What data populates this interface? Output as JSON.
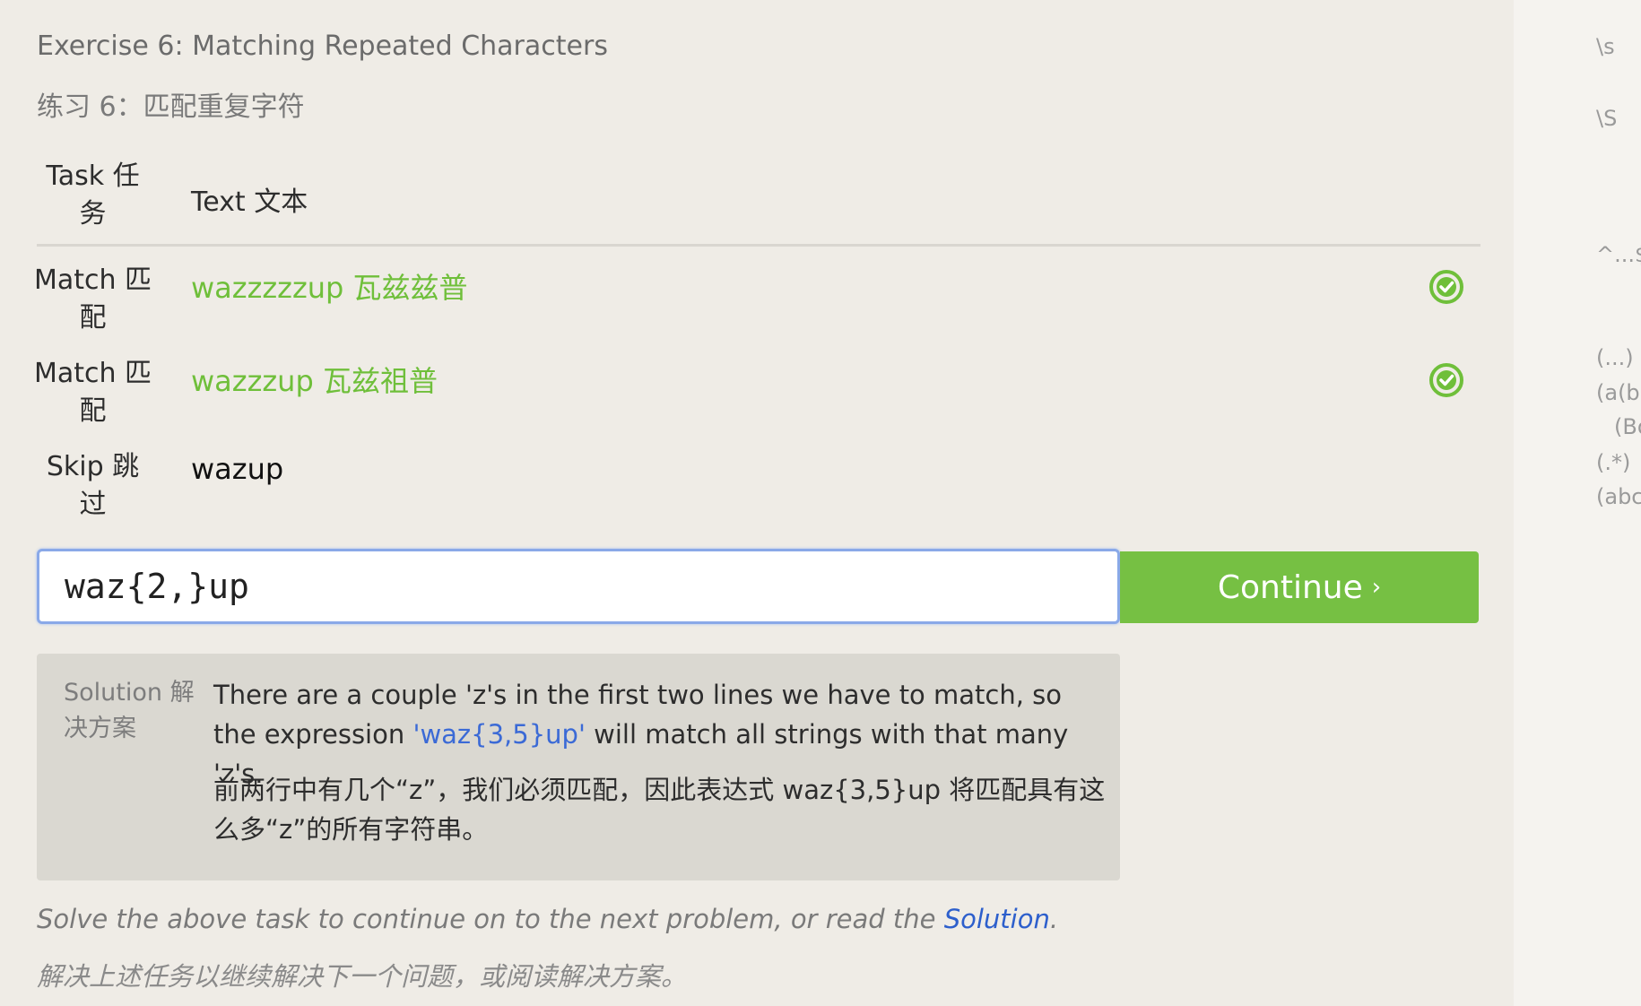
{
  "exercise": {
    "title_en": "Exercise 6: Matching Repeated Characters",
    "title_zh": "练习 6：匹配重复字符"
  },
  "table": {
    "header_task_line1": "Task 任",
    "header_task_line2": "务",
    "header_text": "Text 文本",
    "rows": [
      {
        "task_line1": "Match 匹",
        "task_line2": "配",
        "text": "wazzzzzup 瓦兹兹普",
        "type": "match",
        "status_icon": "check-circle-icon",
        "status_color": "#6fbf3a"
      },
      {
        "task_line1": "Match 匹",
        "task_line2": "配",
        "text": "wazzzup 瓦兹祖普",
        "type": "match",
        "status_icon": "check-circle-icon",
        "status_color": "#6fbf3a"
      },
      {
        "task_line1": "Skip 跳",
        "task_line2": "过",
        "text": "wazup",
        "type": "skip"
      }
    ]
  },
  "regex_input": {
    "value": "waz{2,}up"
  },
  "continue_button": {
    "label": "Continue",
    "chevron": "›",
    "color": "#76c043"
  },
  "solution": {
    "label": "Solution 解决方案",
    "en_before": "There are a couple 'z's in the first two lines we have to match, so the expression ",
    "en_code": "'waz{3,5}up'",
    "en_after": " will match all strings with that many 'z's.",
    "zh": "前两行中有几个“z”，我们必须匹配，因此表达式 waz{3,5}up 将匹配具有这么多“z”的所有字符串。"
  },
  "footer": {
    "en_before": "Solve the above task to continue on to the next problem, or read the ",
    "en_link": "Solution",
    "en_after": ".",
    "zh": "解决上述任务以继续解决下一个问题，或阅读解决方案。"
  },
  "side_panel": {
    "tokens": [
      "\\s",
      "\\S",
      "^...$",
      "(...)",
      "(a(b",
      "(Bo",
      "(.*)",
      "(abc"
    ]
  }
}
